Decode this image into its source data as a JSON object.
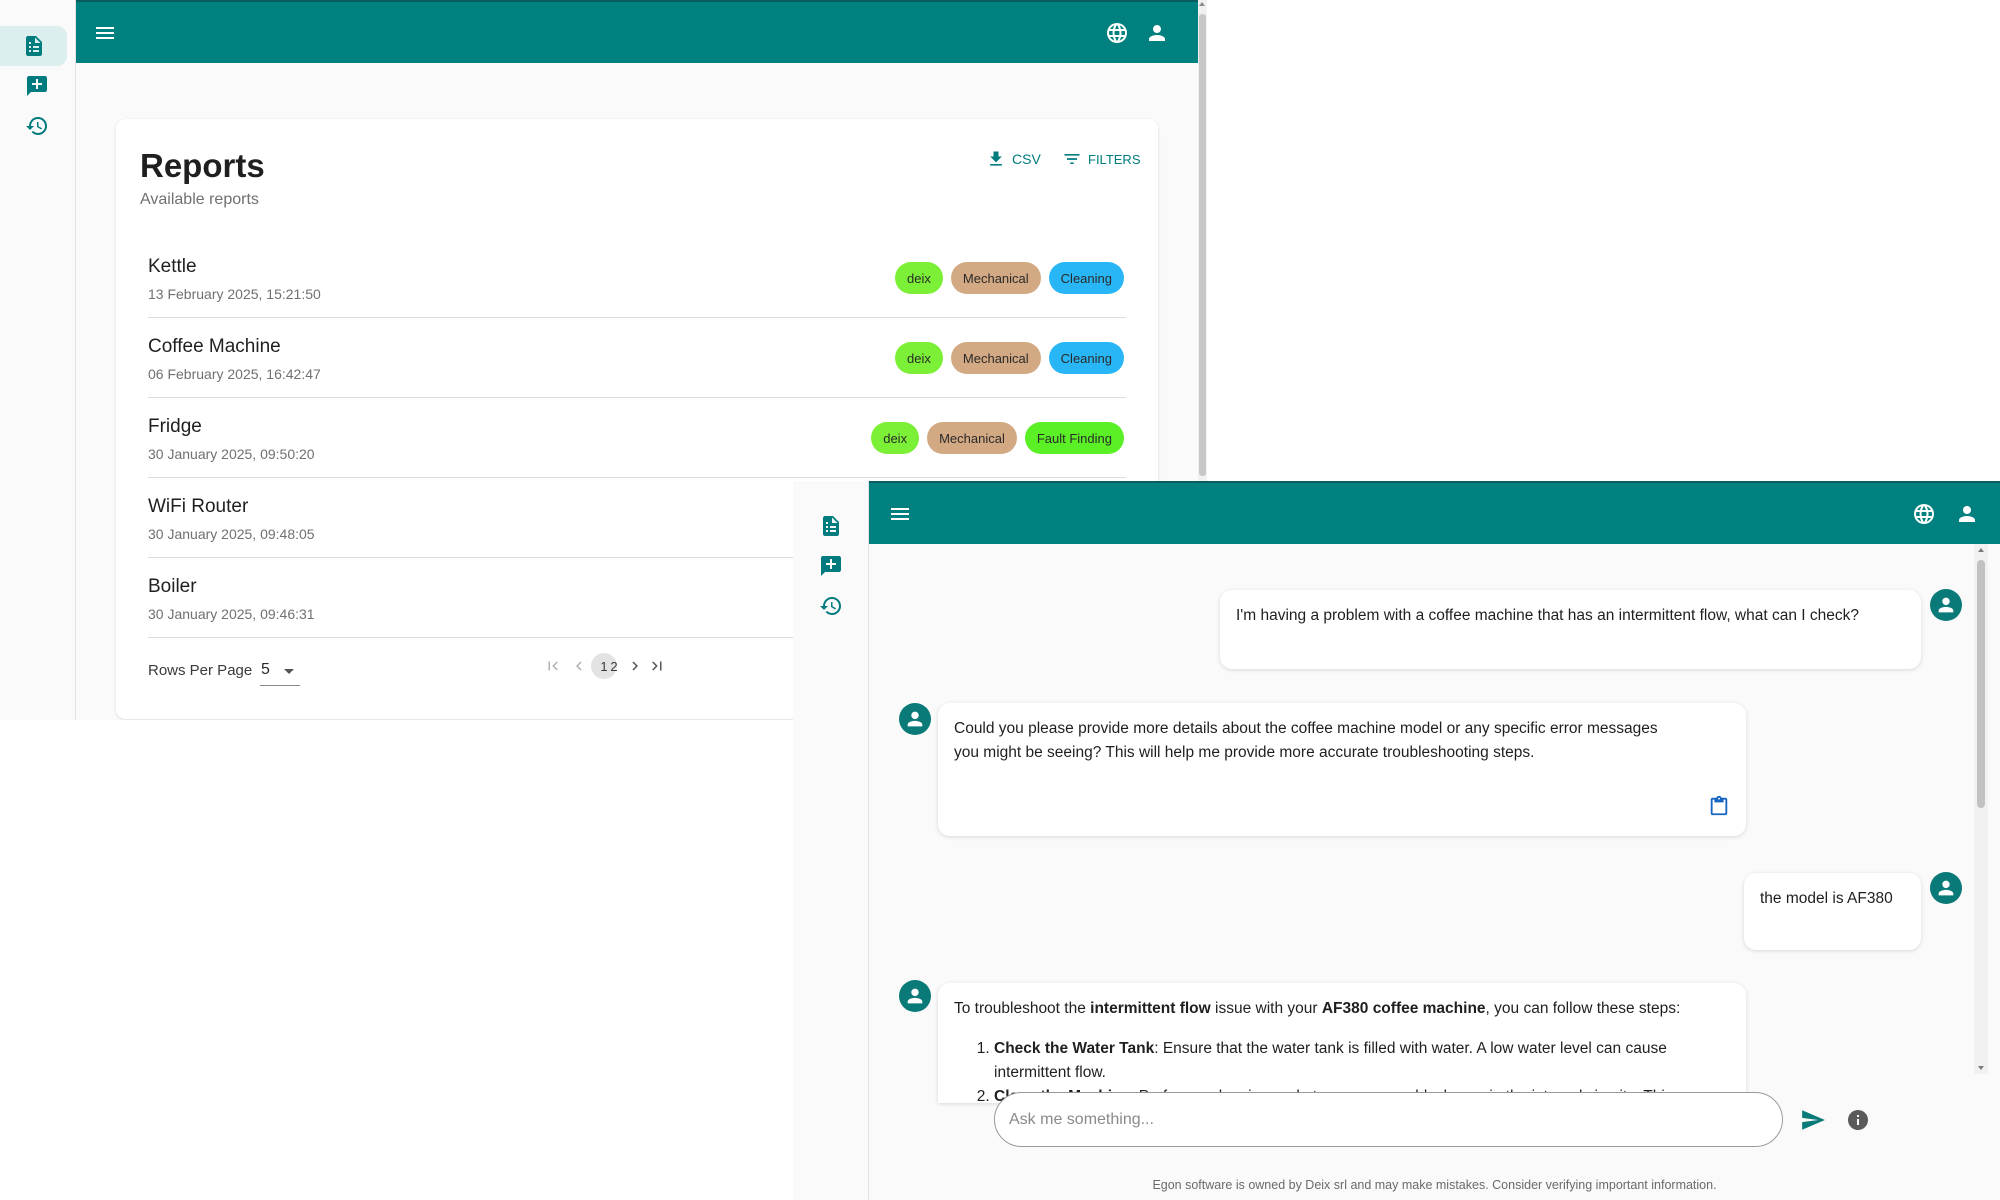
{
  "reports_window": {
    "rail": {
      "items": [
        "reports-icon",
        "new-chat-icon",
        "history-icon"
      ],
      "active": "reports-icon"
    },
    "appbar": {
      "menu_icon": "menu-icon",
      "language_icon": "globe-icon",
      "account_icon": "person-icon"
    },
    "card": {
      "title": "Reports",
      "subtitle": "Available reports",
      "csv_label": "CSV",
      "filters_label": "FILTERS"
    },
    "reports": [
      {
        "name": "Kettle",
        "date": "13 February 2025, 15:21:50",
        "tags": [
          {
            "label": "deix",
            "color": "#7cf037"
          },
          {
            "label": "Mechanical",
            "color": "#d2a983"
          },
          {
            "label": "Cleaning",
            "color": "#29b6f6"
          }
        ]
      },
      {
        "name": "Coffee Machine",
        "date": "06 February 2025, 16:42:47",
        "tags": [
          {
            "label": "deix",
            "color": "#7cf037"
          },
          {
            "label": "Mechanical",
            "color": "#d2a983"
          },
          {
            "label": "Cleaning",
            "color": "#29b6f6"
          }
        ]
      },
      {
        "name": "Fridge",
        "date": "30 January 2025, 09:50:20",
        "tags": [
          {
            "label": "deix",
            "color": "#7cf037"
          },
          {
            "label": "Mechanical",
            "color": "#d2a983"
          },
          {
            "label": "Fault Finding",
            "color": "#5af025"
          }
        ]
      },
      {
        "name": "WiFi Router",
        "date": "30 January 2025, 09:48:05",
        "tags": []
      },
      {
        "name": "Boiler",
        "date": "30 January 2025, 09:46:31",
        "tags": []
      }
    ],
    "pagination": {
      "rows_per_page_label": "Rows Per Page",
      "rows_per_page_value": "5",
      "pages": [
        "1",
        "2"
      ],
      "current_page": "1"
    }
  },
  "chat_window": {
    "rail": {
      "items": [
        "reports-icon",
        "new-chat-icon",
        "history-icon"
      ]
    },
    "appbar": {
      "menu_icon": "menu-icon",
      "language_icon": "globe-icon",
      "account_icon": "person-icon"
    },
    "messages": {
      "user_1": "I'm having a problem with a coffee machine that has an intermittent flow, what can I check?",
      "assistant_1_line1": "Could you please provide more details about the coffee machine model or any specific error messages",
      "assistant_1_line2": "you might be seeing? This will help me provide more accurate troubleshooting steps.",
      "user_2": "the model is AF380",
      "assistant_2": {
        "intro_pre": "To troubleshoot the ",
        "intro_bold1": "intermittent flow",
        "intro_mid": " issue with your ",
        "intro_bold2": "AF380 coffee machine",
        "intro_post": ", you can follow these steps:",
        "step1_bold": "Check the Water Tank",
        "step1_text": ": Ensure that the water tank is filled with water. A low water level can cause intermittent flow.",
        "step2_bold": "Clean the Machine",
        "step2_text": ": Perform a cleaning cycle to remove any blockages in the internal circuits. This"
      }
    },
    "input": {
      "placeholder": "Ask me something..."
    },
    "footer": "Egon software is owned by Deix srl and may make mistakes. Consider verifying important information."
  }
}
